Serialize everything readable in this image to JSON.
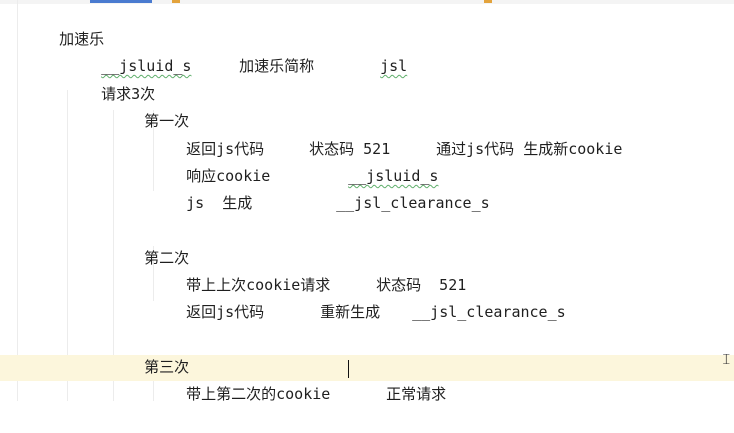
{
  "editor": {
    "lines": {
      "l1": "加速乐",
      "l2a": "__jsluid_s",
      "l2b": "加速乐简称",
      "l2c": "jsl",
      "l3": "请求3次",
      "l4": "第一次",
      "l5a": "返回js代码",
      "l5b": "状态码 521",
      "l5c": "通过js代码 生成新cookie",
      "l6a": "响应cookie",
      "l6b": "__jsluid_s",
      "l7a": "js  生成",
      "l7b": "__jsl_clearance_s",
      "l8": "第二次",
      "l9a": "带上上次cookie请求",
      "l9b": "状态码  521",
      "l10a": "返回js代码",
      "l10b": "重新生成",
      "l10c": "__jsl_clearance_s",
      "l11": "第三次",
      "l12a": "带上第二次的cookie",
      "l12b": "正常请求"
    }
  },
  "colors": {
    "current_line": "#fcf6dc",
    "squiggle": "#5fae6b",
    "text": "#1f1f1f"
  }
}
